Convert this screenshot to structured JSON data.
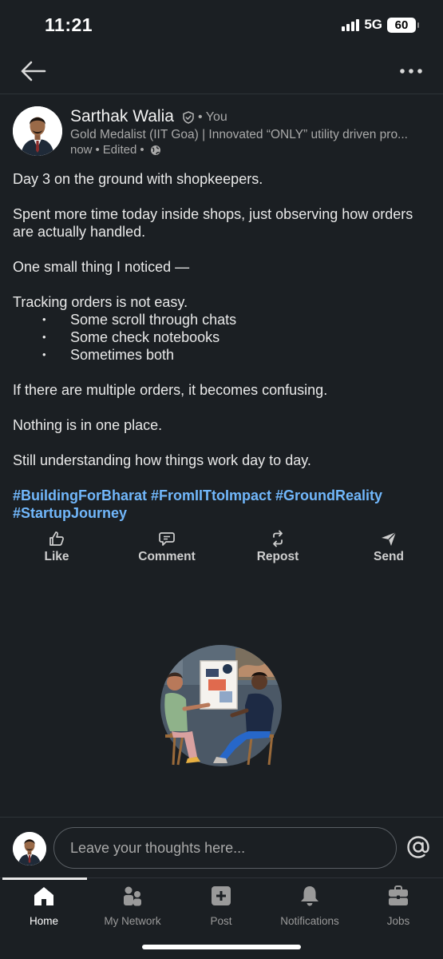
{
  "status_bar": {
    "time": "11:21",
    "network": "5G",
    "battery": "60"
  },
  "post": {
    "author_name": "Sarthak Walia",
    "you_label": "You",
    "separator": "•",
    "headline": "Gold Medalist (IIT Goa) | Innovated “ONLY” utility driven pro...",
    "time": "now",
    "edited": "Edited",
    "paragraphs": {
      "p1": "Day 3 on the ground with shopkeepers.",
      "p2": "Spent more time today inside shops, just observing how orders are actually handled.",
      "p3": "One small thing I noticed —",
      "p4": "Tracking orders is not easy.",
      "p5": "If there are multiple orders, it becomes confusing.",
      "p6": "Nothing is in one place.",
      "p7": "Still understanding how things work day to day."
    },
    "bullets": [
      "Some scroll through chats",
      "Some check notebooks",
      "Sometimes both"
    ],
    "hashtags": "#BuildingForBharat #FromIITtoImpact #GroundReality #StartupJourney"
  },
  "actions": {
    "like": "Like",
    "comment": "Comment",
    "repost": "Repost",
    "send": "Send"
  },
  "comment_box": {
    "placeholder": "Leave your thoughts here..."
  },
  "bottom_nav": {
    "home": "Home",
    "network": "My Network",
    "post": "Post",
    "notifications": "Notifications",
    "jobs": "Jobs"
  },
  "colors": {
    "background": "#1b1f23",
    "link": "#71b7fb",
    "text": "#e9e9e9",
    "muted": "#a9a9a9"
  }
}
